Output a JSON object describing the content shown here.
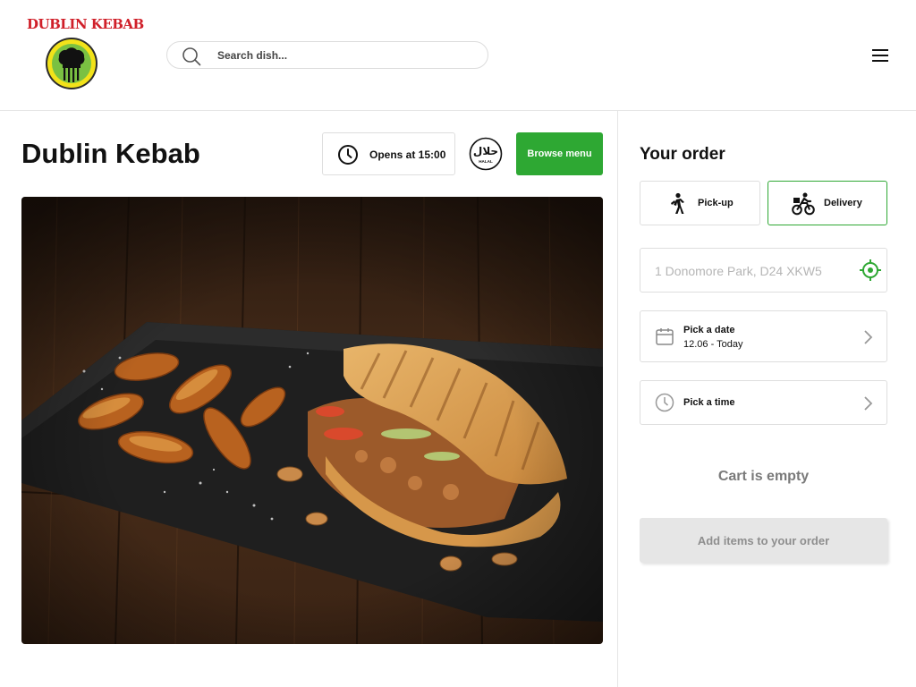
{
  "header": {
    "logo_text": "DUBLIN KEBAB",
    "search": {
      "placeholder": "Search dish...",
      "value": ""
    },
    "menu_icon": "hamburger-menu-icon"
  },
  "restaurant": {
    "name": "Dublin Kebab",
    "hours_label": "Opens at 15:00",
    "hours_icon": "clock-icon",
    "halal_badge": {
      "arabic": "حلال",
      "label": "HALAL"
    },
    "browse_menu_label": "Browse menu"
  },
  "order": {
    "title": "Your order",
    "modes": [
      {
        "label": "Pick-up",
        "icon": "walking-person-icon",
        "selected": false
      },
      {
        "label": "Delivery",
        "icon": "cyclist-icon",
        "selected": true
      }
    ],
    "address": {
      "placeholder": "1 Donomore Park, D24 XKW5",
      "value": "",
      "icon": "locate-target-icon"
    },
    "date_picker": {
      "label": "Pick a date",
      "value": "12.06 - Today",
      "icon": "calendar-icon"
    },
    "time_picker": {
      "label": "Pick a time",
      "icon": "clock-icon"
    },
    "cart_status": "Cart is empty",
    "submit_label": "Add items to your order"
  },
  "colors": {
    "accent_green": "#2ea833",
    "logo_red": "#d0202a",
    "disabled_button_bg": "#e6e6e6",
    "disabled_text": "#8e8e8e"
  }
}
